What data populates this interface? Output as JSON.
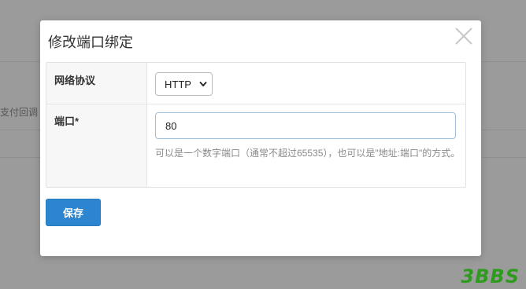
{
  "background": {
    "partial_text": "支付回调"
  },
  "dialog": {
    "title": "修改端口绑定",
    "close_icon": "close-icon"
  },
  "form": {
    "protocol": {
      "label": "网络协议",
      "value": "HTTP"
    },
    "port": {
      "label": "端口*",
      "value": "80",
      "help": "可以是一个数字端口（通常不超过65535），也可以是\"地址:端口\"的方式。"
    }
  },
  "actions": {
    "save_label": "保存"
  },
  "watermark": "3BBS",
  "colors": {
    "primary": "#2d85cf",
    "watermark": "#2e9b1f"
  }
}
